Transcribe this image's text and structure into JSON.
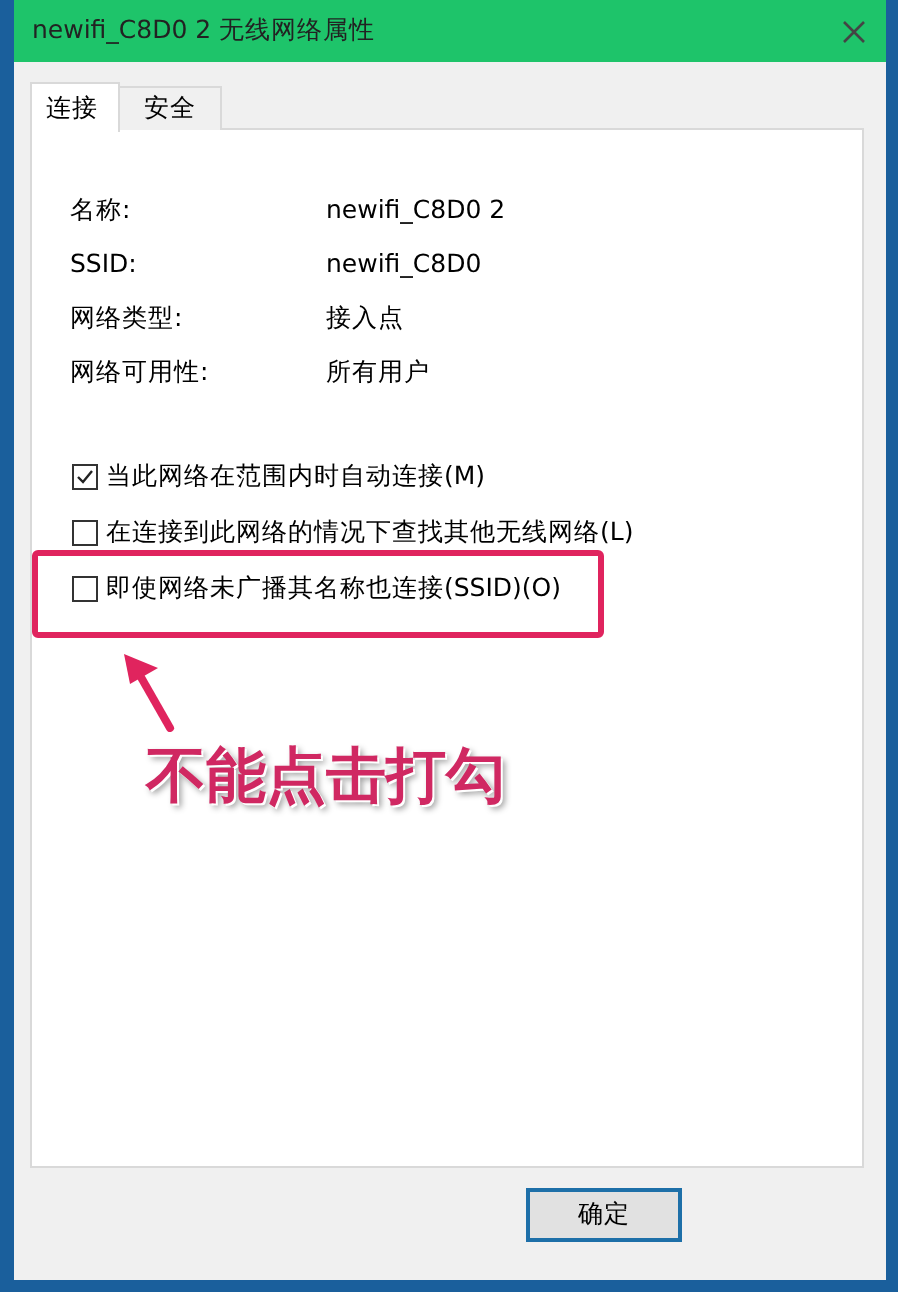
{
  "window": {
    "title": "newifi_C8D0 2 无线网络属性"
  },
  "tabs": [
    {
      "label": "连接",
      "selected": true
    },
    {
      "label": "安全",
      "selected": false
    }
  ],
  "properties": [
    {
      "label": "名称:",
      "value": "newifi_C8D0 2"
    },
    {
      "label": "SSID:",
      "value": "newifi_C8D0"
    },
    {
      "label": "网络类型:",
      "value": "接入点"
    },
    {
      "label": "网络可用性:",
      "value": "所有用户"
    }
  ],
  "options": [
    {
      "label": "当此网络在范围内时自动连接(M)",
      "checked": true
    },
    {
      "label": "在连接到此网络的情况下查找其他无线网络(L)",
      "checked": false
    },
    {
      "label": "即使网络未广播其名称也连接(SSID)(O)",
      "checked": false,
      "highlighted": true
    }
  ],
  "buttons": [
    "确定"
  ],
  "annotation": {
    "text": "不能点击打勾"
  }
}
